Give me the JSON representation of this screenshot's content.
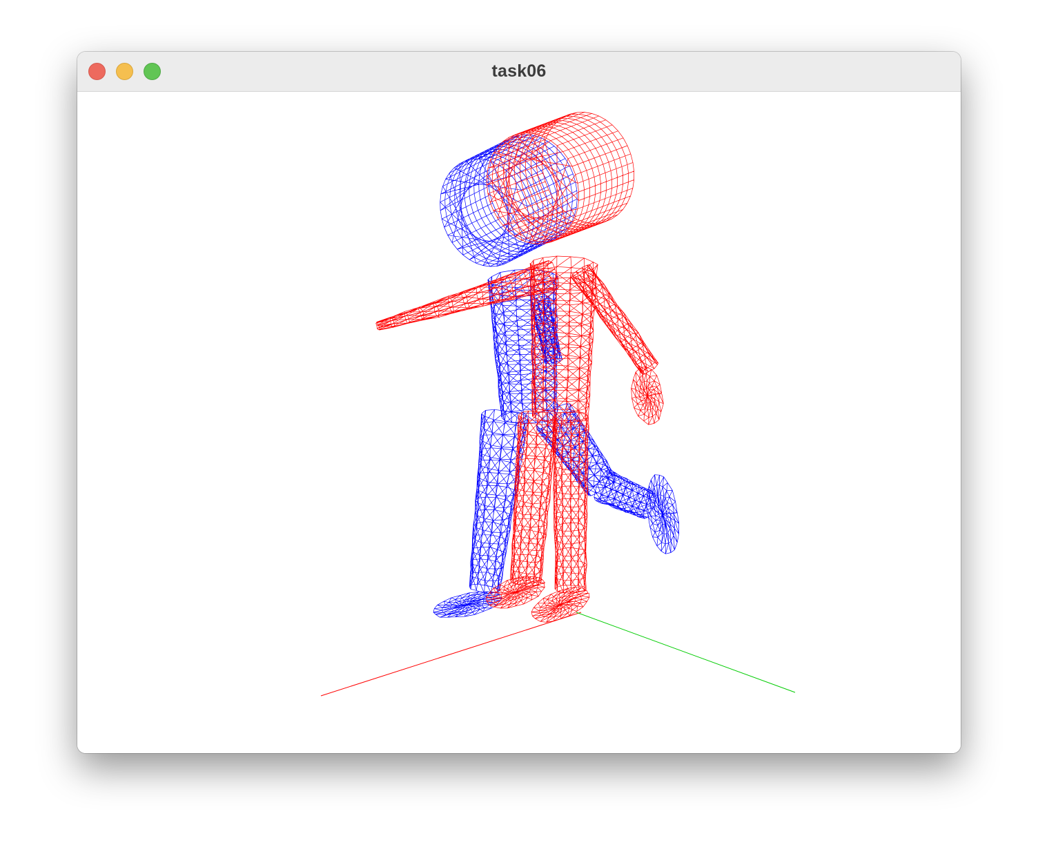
{
  "window": {
    "title": "task06"
  },
  "traffic_lights": {
    "close_color": "#ed6a5e",
    "minimize_color": "#f5bf4f",
    "maximize_color": "#61c554"
  },
  "scene": {
    "background": "#ffffff",
    "models": [
      {
        "name": "blue",
        "color": "#0000ff",
        "render": "wireframe"
      },
      {
        "name": "red",
        "color": "#ff0000",
        "render": "wireframe"
      }
    ],
    "axes": [
      {
        "name": "x",
        "color": "#ff0000"
      },
      {
        "name": "y",
        "color": "#00cc00"
      }
    ]
  }
}
